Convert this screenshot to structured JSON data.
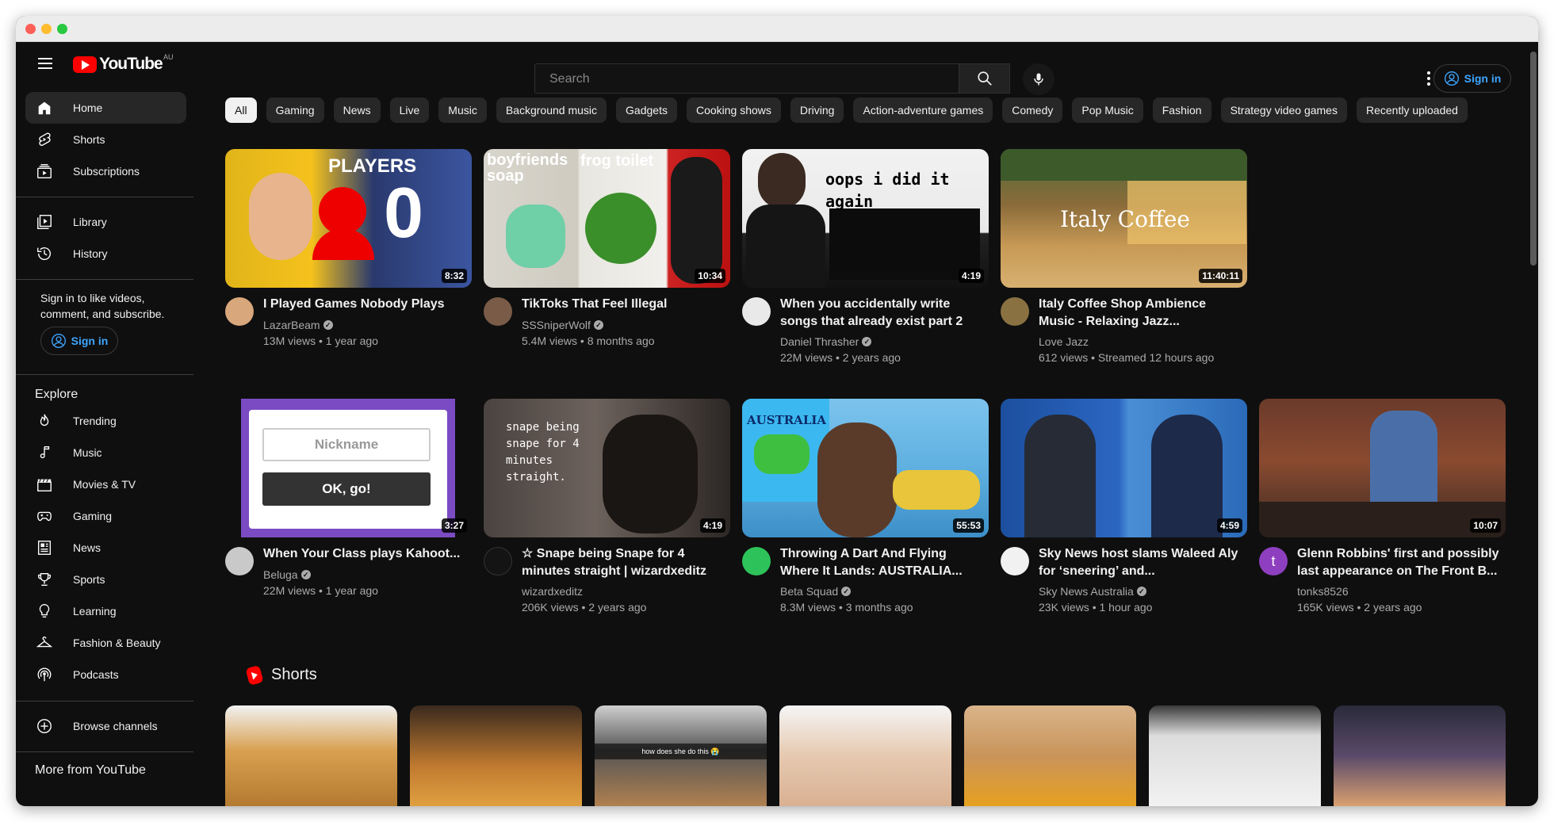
{
  "header": {
    "logo_text": "YouTube",
    "country_code": "AU",
    "search_placeholder": "Search",
    "sign_in": "Sign in"
  },
  "sidebar": {
    "primary": [
      "Home",
      "Shorts",
      "Subscriptions"
    ],
    "library": [
      "Library",
      "History"
    ],
    "signin_message": "Sign in to like videos, comment, and subscribe.",
    "sign_in": "Sign in",
    "explore_title": "Explore",
    "explore": [
      "Trending",
      "Music",
      "Movies & TV",
      "Gaming",
      "News",
      "Sports",
      "Learning",
      "Fashion & Beauty",
      "Podcasts"
    ],
    "browse_channels": "Browse channels",
    "more_title": "More from YouTube"
  },
  "chips": [
    "All",
    "Gaming",
    "News",
    "Live",
    "Music",
    "Background music",
    "Gadgets",
    "Cooking shows",
    "Driving",
    "Action-adventure games",
    "Comedy",
    "Pop Music",
    "Fashion",
    "Strategy video games",
    "Recently uploaded"
  ],
  "videos": [
    {
      "title": "I Played Games Nobody Plays",
      "channel": "LazarBeam",
      "verified": true,
      "meta": "13M views • 1 year ago",
      "duration": "8:32",
      "thumb_text": "PLAYERS",
      "thumb_number": "0"
    },
    {
      "title": "TikToks That Feel Illegal",
      "channel": "SSSniperWolf",
      "verified": true,
      "meta": "5.4M views • 8 months ago",
      "duration": "10:34",
      "thumb_text": "boyfriends soap",
      "thumb_text2": "frog toilet"
    },
    {
      "title": "When you accidentally write songs that already exist part 2",
      "channel": "Daniel Thrasher",
      "verified": true,
      "meta": "22M views • 2 years ago",
      "duration": "4:19",
      "thumb_text": "oops i did it again"
    },
    {
      "title": "Italy Coffee Shop Ambience Music - Relaxing Jazz...",
      "channel": "Love Jazz",
      "verified": false,
      "meta": "612 views • Streamed 12 hours ago",
      "duration": "11:40:11",
      "thumb_text": "Italy Coffee"
    },
    {
      "title": "When Your Class plays Kahoot...",
      "channel": "Beluga",
      "verified": true,
      "meta": "22M views • 1 year ago",
      "duration": "3:27",
      "thumb_text": "Nickname",
      "thumb_text2": "OK, go!"
    },
    {
      "title": "☆ Snape being Snape for 4 minutes straight | wizardxeditz",
      "channel": "wizardxeditz",
      "verified": false,
      "meta": "206K views • 2 years ago",
      "duration": "4:19",
      "thumb_text": "snape being snape for 4 minutes straight."
    },
    {
      "title": "Throwing A Dart And Flying Where It Lands: AUSTRALIA...",
      "channel": "Beta Squad",
      "verified": true,
      "meta": "8.3M views • 3 months ago",
      "duration": "55:53",
      "thumb_text": "AUSTRALIA"
    },
    {
      "title": "Sky News host slams Waleed Aly for ‘sneering’ and...",
      "channel": "Sky News Australia",
      "verified": true,
      "meta": "23K views • 1 hour ago",
      "duration": "4:59"
    },
    {
      "title": "Glenn Robbins' first and possibly last appearance on The Front B...",
      "channel": "tonks8526",
      "verified": false,
      "meta": "165K views • 2 years ago",
      "duration": "10:07",
      "avatar_letter": "t"
    }
  ],
  "shorts": {
    "title": "Shorts",
    "items": [
      {
        "caption": ""
      },
      {
        "caption": ""
      },
      {
        "caption": "how does she do this 😭"
      },
      {
        "caption": ""
      },
      {
        "caption": ""
      },
      {
        "caption": ""
      },
      {
        "caption": ""
      }
    ]
  }
}
